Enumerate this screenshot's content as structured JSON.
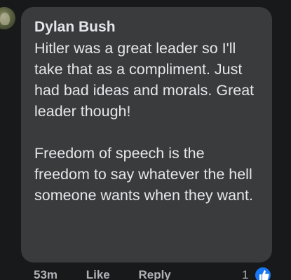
{
  "comment": {
    "author": "Dylan Bush",
    "paragraphs": [
      "Hitler was a great leader so I'll take that as a compliment. Just had bad ideas and morals. Great leader though!",
      "Freedom of speech is the freedom to say whatever the hell someone wants when they want."
    ],
    "timestamp": "53m",
    "like_label": "Like",
    "reply_label": "Reply",
    "reaction_count": "1",
    "reaction_icon": "thumbs-up-icon"
  },
  "colors": {
    "background": "#18191a",
    "bubble": "#3a3b3c",
    "text": "#e4e6eb",
    "secondary_text": "#b0b3b8",
    "like_blue": "#1877f2"
  }
}
